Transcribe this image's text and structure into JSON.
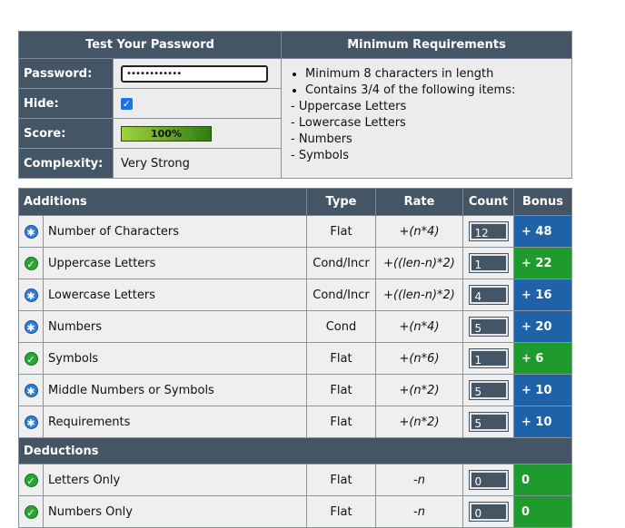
{
  "top": {
    "test_header": "Test Your Password",
    "req_header": "Minimum Requirements",
    "password_label": "Password:",
    "password_mask": "••••••••••••",
    "hide_label": "Hide:",
    "score_label": "Score:",
    "score_text": "100%",
    "complexity_label": "Complexity:",
    "complexity_value": "Very Strong",
    "req_items": [
      "Minimum 8 characters in length",
      "Contains 3/4 of the following items:"
    ],
    "req_sub": [
      "- Uppercase Letters",
      "- Lowercase Letters",
      "- Numbers",
      "- Symbols"
    ]
  },
  "grid": {
    "headers": {
      "additions": "Additions",
      "type": "Type",
      "rate": "Rate",
      "count": "Count",
      "bonus": "Bonus"
    },
    "additions": [
      {
        "name": "Number of Characters",
        "type": "Flat",
        "rate": "+(n*4)",
        "count": "12",
        "bonus": "+ 48",
        "status": "exceed"
      },
      {
        "name": "Uppercase Letters",
        "type": "Cond/Incr",
        "rate": "+((len-n)*2)",
        "count": "1",
        "bonus": "+ 22",
        "status": "pass"
      },
      {
        "name": "Lowercase Letters",
        "type": "Cond/Incr",
        "rate": "+((len-n)*2)",
        "count": "4",
        "bonus": "+ 16",
        "status": "exceed"
      },
      {
        "name": "Numbers",
        "type": "Cond",
        "rate": "+(n*4)",
        "count": "5",
        "bonus": "+ 20",
        "status": "exceed"
      },
      {
        "name": "Symbols",
        "type": "Flat",
        "rate": "+(n*6)",
        "count": "1",
        "bonus": "+ 6",
        "status": "pass"
      },
      {
        "name": "Middle Numbers or Symbols",
        "type": "Flat",
        "rate": "+(n*2)",
        "count": "5",
        "bonus": "+ 10",
        "status": "exceed"
      },
      {
        "name": "Requirements",
        "type": "Flat",
        "rate": "+(n*2)",
        "count": "5",
        "bonus": "+ 10",
        "status": "exceed"
      }
    ],
    "deductions_label": "Deductions",
    "deductions": [
      {
        "name": "Letters Only",
        "type": "Flat",
        "rate": "-n",
        "count": "0",
        "bonus": "0",
        "status": "pass"
      },
      {
        "name": "Numbers Only",
        "type": "Flat",
        "rate": "-n",
        "count": "0",
        "bonus": "0",
        "status": "pass"
      }
    ]
  },
  "colors": {
    "header_bg": "#445566",
    "exceed": "#1f62a8",
    "pass": "#1f9a2c"
  }
}
